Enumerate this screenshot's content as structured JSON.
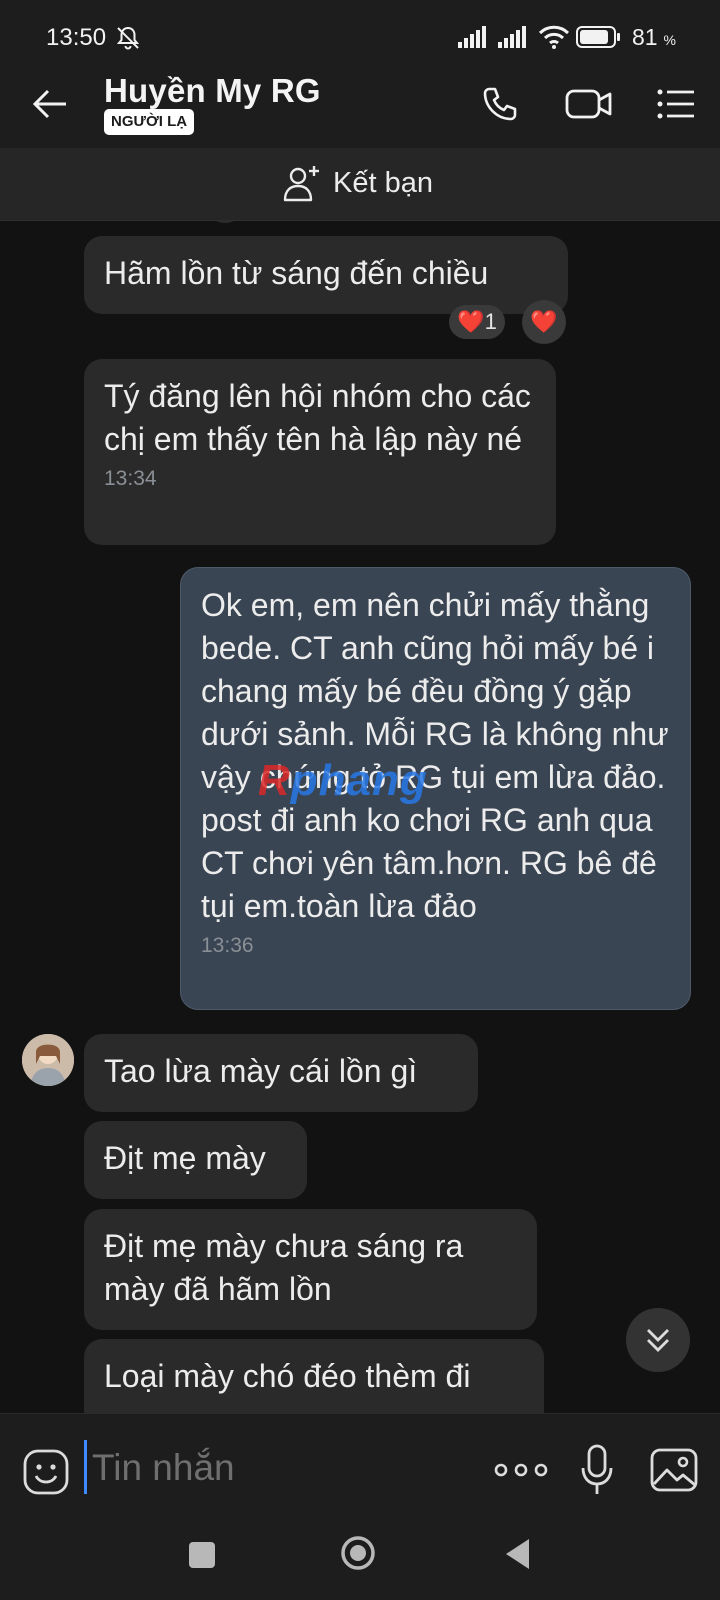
{
  "status_bar": {
    "time": "13:50",
    "battery": "81",
    "battery_unit": "%",
    "icons": [
      "bell-muted-icon",
      "signal-icon",
      "signal-icon",
      "wifi-icon",
      "battery-icon"
    ]
  },
  "header": {
    "contact_name": "Huyền My RG",
    "badge": "NGƯỜI LẠ",
    "icons": [
      "back-arrow-icon",
      "phone-call-icon",
      "video-call-icon",
      "menu-list-icon"
    ]
  },
  "friend_bar": {
    "label": "Kết bạn",
    "icon": "add-friend-icon"
  },
  "messages": [
    {
      "direction": "in",
      "text": "Hãm lồn từ sáng đến chiều",
      "reactions": [
        {
          "emoji": "❤️",
          "count": "1"
        },
        {
          "emoji": "❤️"
        }
      ]
    },
    {
      "direction": "in",
      "text": "Tý đăng lên hội nhóm cho các chị em thấy tên hà lập này né",
      "time": "13:34"
    },
    {
      "direction": "out",
      "text": "Ok em, em nên chửi mấy thằng bede. CT anh cũng hỏi mấy bé i chang mấy bé đều đồng ý gặp dưới sảnh. Mỗi RG là không như vậy chứng tỏ RG tụi em lừa đảo. post đi anh ko chơi RG anh qua CT chơi yên tâm.hơn. RG bê đê tụi em.toàn lừa đảo",
      "time": "13:36"
    },
    {
      "direction": "in",
      "text": "Tao lừa mày cái lồn gì"
    },
    {
      "direction": "in",
      "text": "Địt mẹ mày"
    },
    {
      "direction": "in",
      "text": "Địt mẹ mày chưa sáng ra mày đã hãm lồn"
    },
    {
      "direction": "in",
      "text": "Loại mày chó đéo thèm đi"
    }
  ],
  "watermark": {
    "part1": "R",
    "part2": "phang"
  },
  "composer": {
    "placeholder": "Tin nhắn",
    "icons": [
      "emoji-sticker-icon",
      "more-options-icon",
      "microphone-icon",
      "gallery-icon"
    ]
  },
  "colors": {
    "background": "#121212",
    "incoming_bubble": "#2a2a2a",
    "outgoing_bubble": "#3a4553",
    "accent_caret": "#3d8bff",
    "heart": "#e0245e"
  }
}
